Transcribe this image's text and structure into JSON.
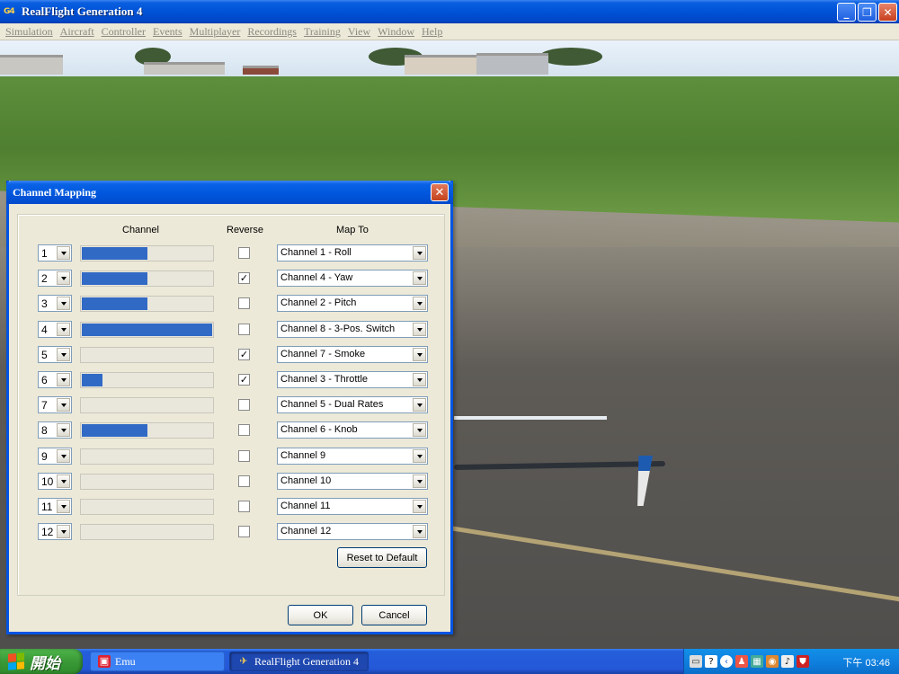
{
  "window": {
    "title": "RealFlight Generation 4",
    "app_icon": "G4"
  },
  "menu": [
    "Simulation",
    "Aircraft",
    "Controller",
    "Events",
    "Multiplayer",
    "Recordings",
    "Training",
    "View",
    "Window",
    "Help"
  ],
  "dialog": {
    "title": "Channel Mapping",
    "headers": {
      "channel": "Channel",
      "reverse": "Reverse",
      "map_to": "Map To"
    },
    "rows": [
      {
        "num": "1",
        "level": 0.5,
        "reverse": false,
        "map": "Channel 1 - Roll"
      },
      {
        "num": "2",
        "level": 0.5,
        "reverse": true,
        "map": "Channel 4 - Yaw"
      },
      {
        "num": "3",
        "level": 0.5,
        "reverse": false,
        "map": "Channel 2 - Pitch"
      },
      {
        "num": "4",
        "level": 1.0,
        "reverse": false,
        "map": "Channel 8 - 3-Pos. Switch"
      },
      {
        "num": "5",
        "level": 0.0,
        "reverse": true,
        "map": "Channel 7 - Smoke"
      },
      {
        "num": "6",
        "level": 0.16,
        "reverse": true,
        "map": "Channel 3 - Throttle"
      },
      {
        "num": "7",
        "level": 0.0,
        "reverse": false,
        "map": "Channel 5 - Dual Rates"
      },
      {
        "num": "8",
        "level": 0.5,
        "reverse": false,
        "map": "Channel 6 - Knob"
      },
      {
        "num": "9",
        "level": 0.0,
        "reverse": false,
        "map": "Channel 9"
      },
      {
        "num": "10",
        "level": 0.0,
        "reverse": false,
        "map": "Channel 10"
      },
      {
        "num": "11",
        "level": 0.0,
        "reverse": false,
        "map": "Channel 11"
      },
      {
        "num": "12",
        "level": 0.0,
        "reverse": false,
        "map": "Channel 12"
      }
    ],
    "reset_label": "Reset to Default",
    "ok_label": "OK",
    "cancel_label": "Cancel",
    "bar_color": "#316ac5"
  },
  "taskbar": {
    "start_label": "開始",
    "tasks": [
      {
        "label": "Emu",
        "icon": "emu-icon"
      },
      {
        "label": "RealFlight Generation 4",
        "icon": "realflight-icon"
      }
    ],
    "clock": "下午 03:46"
  }
}
